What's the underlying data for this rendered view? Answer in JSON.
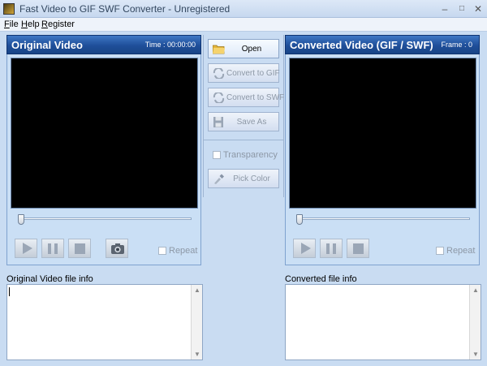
{
  "window": {
    "title": "Fast Video to GIF SWF Converter - Unregistered"
  },
  "menu": {
    "items": [
      "File",
      "Help",
      "Register"
    ]
  },
  "left_panel": {
    "title": "Original Video",
    "time_label": "Time : 00:00:00",
    "repeat_label": "Repeat",
    "slider_position": 0
  },
  "right_panel": {
    "title": "Converted Video (GIF / SWF)",
    "frame_label": "Frame : 0",
    "repeat_label": "Repeat",
    "slider_position": 0
  },
  "actions": {
    "open": "Open",
    "convert_gif": "Convert to GIF",
    "convert_swf": "Convert to SWF",
    "save_as": "Save As",
    "transparency": "Transparency",
    "pick_color": "Pick Color"
  },
  "info": {
    "original_label": "Original Video file info",
    "converted_label": "Converted file info",
    "original_text": "",
    "converted_text": ""
  },
  "colors": {
    "header_blue": "#1f4f9a",
    "panel_bg": "#cadff5",
    "screen": "#000000"
  }
}
